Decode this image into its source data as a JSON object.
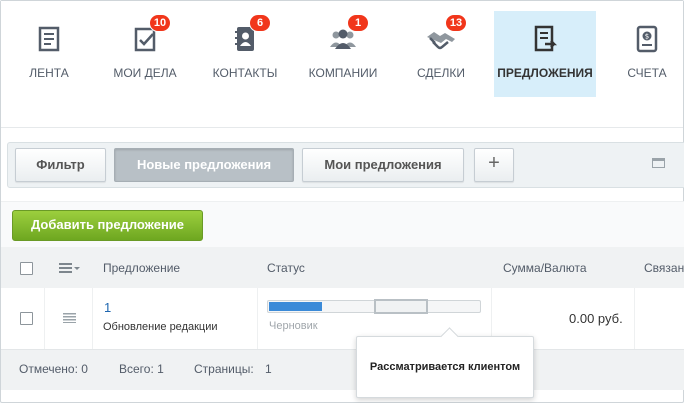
{
  "nav": {
    "items": [
      {
        "label": "ЛЕНТА",
        "icon": "feed-icon",
        "badge": ""
      },
      {
        "label": "МОИ ДЕЛА",
        "icon": "tasks-icon",
        "badge": "10"
      },
      {
        "label": "КОНТАКТЫ",
        "icon": "contacts-icon",
        "badge": "6"
      },
      {
        "label": "КОМПАНИИ",
        "icon": "companies-icon",
        "badge": "1"
      },
      {
        "label": "СДЕЛКИ",
        "icon": "deals-icon",
        "badge": "13"
      },
      {
        "label": "ПРЕДЛОЖЕНИЯ",
        "icon": "quotes-icon",
        "badge": "",
        "active": true
      },
      {
        "label": "СЧЕТА",
        "icon": "invoices-icon",
        "badge": ""
      }
    ]
  },
  "filter": {
    "filter_label": "Фильтр",
    "preset_new": "Новые предложения",
    "preset_mine": "Мои предложения",
    "add_preset": "+"
  },
  "toolbar": {
    "add_label": "Добавить предложение"
  },
  "grid": {
    "columns": [
      "Предложение",
      "Статус",
      "Сумма/Валюта",
      "Связан"
    ],
    "rows": [
      {
        "number": "1",
        "title": "Обновление редакции",
        "status_label": "Черновик",
        "status_progress": 0.25,
        "amount": "0.00 руб."
      }
    ]
  },
  "footer": {
    "selected": "Отмечено: 0",
    "total": "Всего: 1",
    "pages_label": "Страницы:",
    "pages_value": "1"
  },
  "tooltip": {
    "text": "Рассматривается клиентом"
  },
  "colors": {
    "accent_blue": "#3b8ad8",
    "add_green": "#7ab52b",
    "badge_red": "#f1361b",
    "active_tab_bg": "#d7eefa"
  }
}
